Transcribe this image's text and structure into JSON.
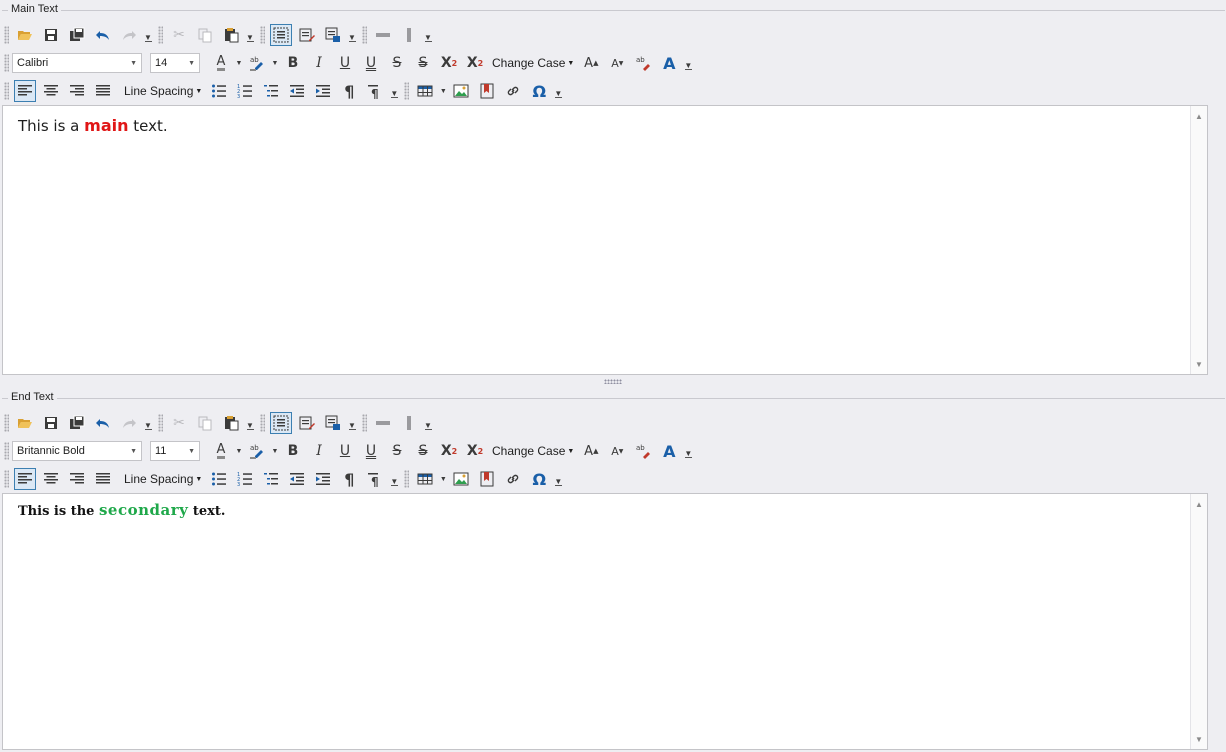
{
  "colors": {
    "accent_blue": "#1a5fa8",
    "main_highlight": "#e01616",
    "secondary_highlight": "#1fa84a",
    "window_bg": "#eeeef2"
  },
  "panels": [
    {
      "legend": "Main Text",
      "font_name": "Calibri",
      "font_size": "14",
      "line_spacing_label": "Line Spacing",
      "change_case_label": "Change Case",
      "content_runs": [
        "This is a ",
        "main",
        " text."
      ]
    },
    {
      "legend": "End Text",
      "font_name": "Britannic Bold",
      "font_size": "11",
      "line_spacing_label": "Line Spacing",
      "change_case_label": "Change Case",
      "content_runs": [
        "This is the ",
        "secondary",
        " text."
      ]
    }
  ],
  "icons": {
    "open": "folder-open-icon",
    "save": "save-icon",
    "save_as": "save-all-icon",
    "undo": "undo-icon",
    "redo": "redo-icon",
    "cut": "cut-icon",
    "copy": "copy-icon",
    "paste": "paste-icon",
    "select_all": "select-all-icon",
    "edit": "edit-document-icon",
    "print": "print-preview-icon",
    "hr": "horizontal-rule-icon",
    "column": "column-break-icon",
    "bold": "B",
    "italic": "I",
    "underline": "U",
    "double_underline": "U",
    "strike": "S",
    "double_strike": "S",
    "superscript": "X²",
    "subscript": "X₂",
    "font_color": "A",
    "grow_font": "A",
    "shrink_font": "A",
    "paragraph": "¶"
  }
}
